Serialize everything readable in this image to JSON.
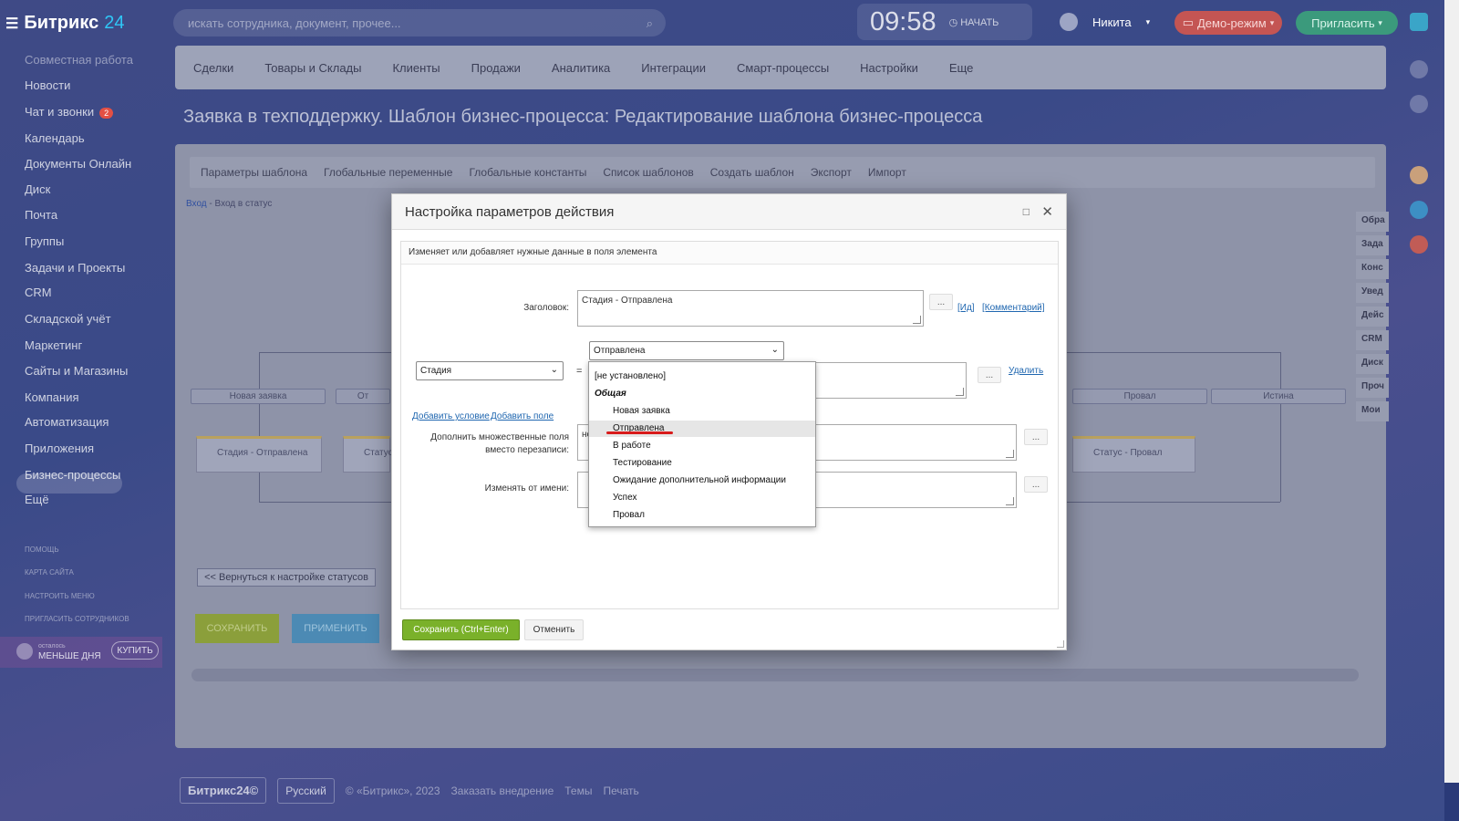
{
  "header": {
    "logo_text": "Битрикс",
    "logo_num": "24",
    "search_placeholder": "искать сотрудника, документ, прочее...",
    "time": "09:58",
    "start_label": "НАЧАТЬ",
    "user_name": "Никита",
    "demo_label": "Демо-режим",
    "invite_label": "Пригласить"
  },
  "sidebar": {
    "group_title": "Совместная работа",
    "items": [
      "Новости",
      "Чат и звонки",
      "Календарь",
      "Документы Онлайн",
      "Диск",
      "Почта",
      "Группы",
      "Задачи и Проекты",
      "CRM",
      "Складской учёт",
      "Маркетинг",
      "Сайты и Магазины",
      "Компания",
      "Автоматизация",
      "Приложения",
      "Бизнес-процессы",
      "Ещё"
    ],
    "chat_badge": "2",
    "small_links": [
      "ПОМОЩЬ",
      "КАРТА САЙТА",
      "НАСТРОИТЬ МЕНЮ",
      "ПРИГЛАСИТЬ СОТРУДНИКОВ"
    ],
    "trial_small": "осталось",
    "trial_text": "МЕНЬШЕ ДНЯ",
    "buy_label": "КУПИТЬ"
  },
  "nav": [
    "Сделки",
    "Товары и Склады",
    "Клиенты",
    "Продажи",
    "Аналитика",
    "Интеграции",
    "Смарт-процессы",
    "Настройки",
    "Еще"
  ],
  "page_title": "Заявка в техподдержку. Шаблон бизнес-процесса: Редактирование шаблона бизнес-процесса",
  "toolbar": [
    "Параметры шаблона",
    "Глобальные переменные",
    "Глобальные константы",
    "Список шаблонов",
    "Создать шаблон",
    "Экспорт",
    "Импорт"
  ],
  "breadcrumb": {
    "link": "Вход",
    "sep": " - ",
    "current": "Вход в статус"
  },
  "diagram": {
    "states": [
      "Новая заявка",
      "От",
      "Провал",
      "Истина"
    ],
    "actions": [
      "Стадия - Отправлена",
      "Статус",
      "Статус - Провал"
    ]
  },
  "right_list": [
    "Обра",
    "Зада",
    "Конс",
    "Увед",
    "Дейс",
    "CRM",
    "Диск",
    "Проч",
    "Мои"
  ],
  "back_button": "<< Вернуться к настройке статусов",
  "save_bg": "СОХРАНИТЬ",
  "apply_bg": "ПРИМЕНИТЬ",
  "footer": {
    "logo": "Битрикс24©",
    "lang": "Русский",
    "copyright": "© «Битрикс», 2023",
    "order": "Заказать внедрение",
    "themes": "Темы",
    "print": "Печать"
  },
  "modal": {
    "title": "Настройка параметров действия",
    "description": "Изменяет или добавляет нужные данные в поля элемента",
    "title_label": "Заголовок:",
    "title_value": "Стадия - Отправлена",
    "dots": "...",
    "link_id": "[Ид]",
    "link_comment": "[Комментарий]",
    "field_select": "Стадия",
    "value_select": "Отправлена",
    "eq": "=",
    "delete_link": "Удалить",
    "add_condition": "Добавить условие",
    "add_field": "Добавить поле",
    "multi_label": "Дополнить множественные поля вместо перезаписи:",
    "multi_value": "не",
    "from_label": "Изменять от имени:",
    "save_btn": "Сохранить (Ctrl+Enter)",
    "cancel_btn": "Отменить"
  },
  "dropdown": {
    "options": [
      "[не установлено]",
      "Общая",
      "Новая заявка",
      "Отправлена",
      "В работе",
      "Тестирование",
      "Ожидание дополнительной информации",
      "Успех",
      "Провал"
    ],
    "highlighted": "Отправлена"
  }
}
